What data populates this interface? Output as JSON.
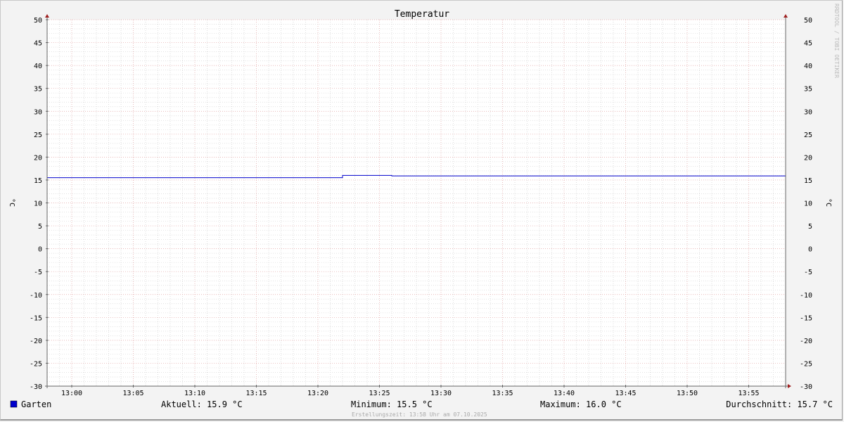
{
  "chart_data": {
    "type": "line",
    "title": "Temperatur",
    "ylabel": "°C",
    "ylabel_right": "°C",
    "ylim": [
      -30,
      50
    ],
    "yticks": [
      50,
      45,
      40,
      35,
      30,
      25,
      20,
      15,
      10,
      5,
      0,
      -5,
      -10,
      -15,
      -20,
      -25,
      -30
    ],
    "xlim": [
      "12:58",
      "13:58"
    ],
    "xticks": [
      "13:00",
      "13:05",
      "13:10",
      "13:15",
      "13:20",
      "13:25",
      "13:30",
      "13:35",
      "13:40",
      "13:45",
      "13:50",
      "13:55"
    ],
    "grid": true,
    "series": [
      {
        "name": "Garten",
        "color": "#0000cc",
        "points": [
          [
            "12:58",
            15.5
          ],
          [
            "13:22",
            15.5
          ],
          [
            "13:22",
            16.0
          ],
          [
            "13:26",
            16.0
          ],
          [
            "13:26",
            15.9
          ],
          [
            "13:58",
            15.9
          ]
        ]
      }
    ],
    "watermark": "RRDTOOL / TOBI OETIKER"
  },
  "legend": {
    "series_name": "Garten",
    "swatch_color": "#0000cc",
    "current": "Aktuell: 15.9 °C",
    "minimum": "Minimum: 15.5 °C",
    "maximum": "Maximum: 16.0 °C",
    "average": "Durchschnitt: 15.7 °C"
  },
  "footer": "Erstellungszeit: 13:58 Uhr am 07.10.2025"
}
